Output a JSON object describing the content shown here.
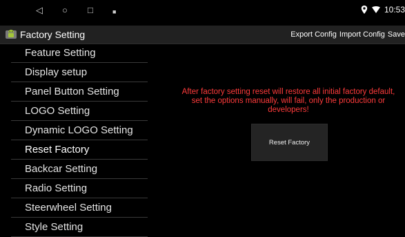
{
  "statusbar": {
    "nav": {
      "back": "◁",
      "home": "○",
      "recents": "□",
      "notify": "■"
    },
    "time": "10:53",
    "icons": [
      "location-icon",
      "wifi-icon"
    ]
  },
  "actionbar": {
    "title": "Factory Setting",
    "icon": "android-settings-icon",
    "actions": [
      "Export Config",
      "Import Config",
      "Save"
    ]
  },
  "menu": {
    "selected": "Reset Factory",
    "items": [
      "Feature Setting",
      "Display setup",
      "Panel Button Setting",
      "LOGO Setting",
      "Dynamic LOGO Setting",
      "Reset Factory",
      "Backcar Setting",
      "Radio Setting",
      "Steerwheel Setting",
      "Style Setting"
    ]
  },
  "content": {
    "warning": "After factory setting reset will restore all initial factory default, set the options manually, will fail, only the production or developers!",
    "reset_button": "Reset Factory"
  },
  "colors": {
    "background": "#000000",
    "actionbar": "#212121",
    "warning": "#ff3b3b",
    "text": "#e4e4e4"
  }
}
